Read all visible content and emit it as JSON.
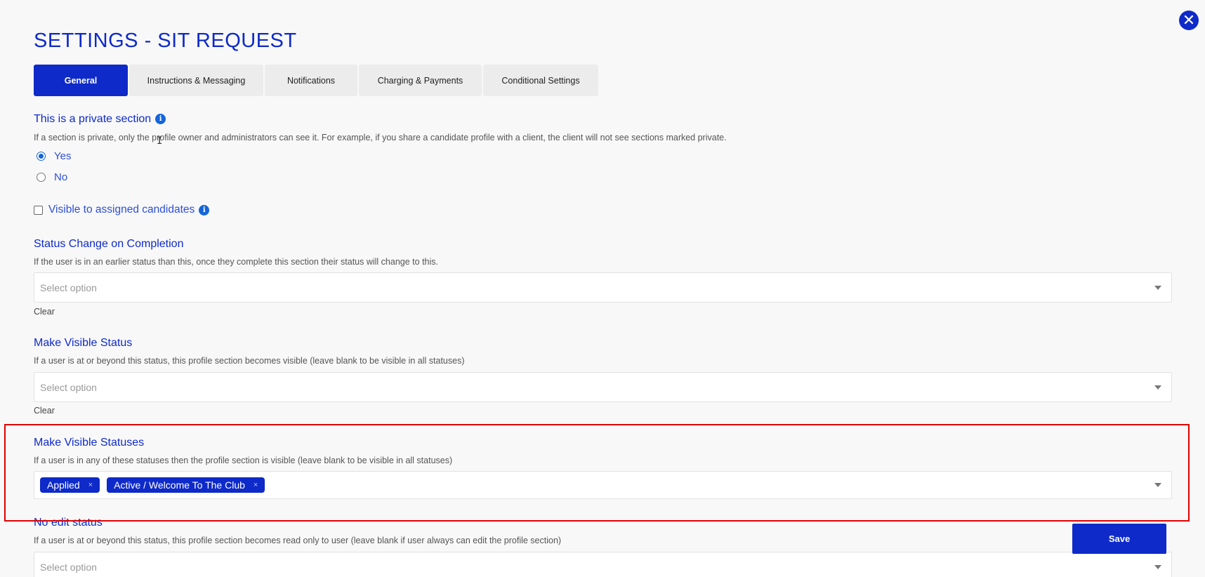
{
  "title": "SETTINGS - SIT REQUEST",
  "tabs": [
    {
      "label": "General",
      "active": true
    },
    {
      "label": "Instructions & Messaging",
      "active": false
    },
    {
      "label": "Notifications",
      "active": false
    },
    {
      "label": "Charging & Payments",
      "active": false
    },
    {
      "label": "Conditional Settings",
      "active": false
    }
  ],
  "private_section": {
    "label": "This is a private section",
    "description": "If a section is private, only the profile owner and administrators can see it. For example, if you share a candidate profile with a client, the client will not see sections marked private.",
    "options": [
      {
        "label": "Yes",
        "checked": true
      },
      {
        "label": "No",
        "checked": false
      }
    ]
  },
  "visible_to_candidates": {
    "label": "Visible to assigned candidates",
    "checked": false
  },
  "status_change": {
    "label": "Status Change on Completion",
    "description": "If the user is in an earlier status than this, once they complete this section their status will change to this.",
    "placeholder": "Select option",
    "clear_label": "Clear"
  },
  "make_visible_status": {
    "label": "Make Visible Status",
    "description": "If a user is at or beyond this status, this profile section becomes visible (leave blank to be visible in all statuses)",
    "placeholder": "Select option",
    "clear_label": "Clear"
  },
  "make_visible_statuses": {
    "label": "Make Visible Statuses",
    "description": "If a user is in any of these statuses then the profile section is visible (leave blank to be visible in all statuses)",
    "tags": [
      "Applied",
      "Active / Welcome To The Club"
    ],
    "tag_remove": "×"
  },
  "no_edit_status": {
    "label": "No edit status",
    "description": "If a user is at or beyond this status, this profile section becomes read only to user (leave blank if user always can edit the profile section)",
    "placeholder": "Select option"
  },
  "save_label": "Save",
  "close_symbol": "✕",
  "info_symbol": "i",
  "text_cursor": "I",
  "colors": {
    "accent": "#0e2ac9",
    "highlight": "#e00000",
    "info": "#1565d8"
  }
}
